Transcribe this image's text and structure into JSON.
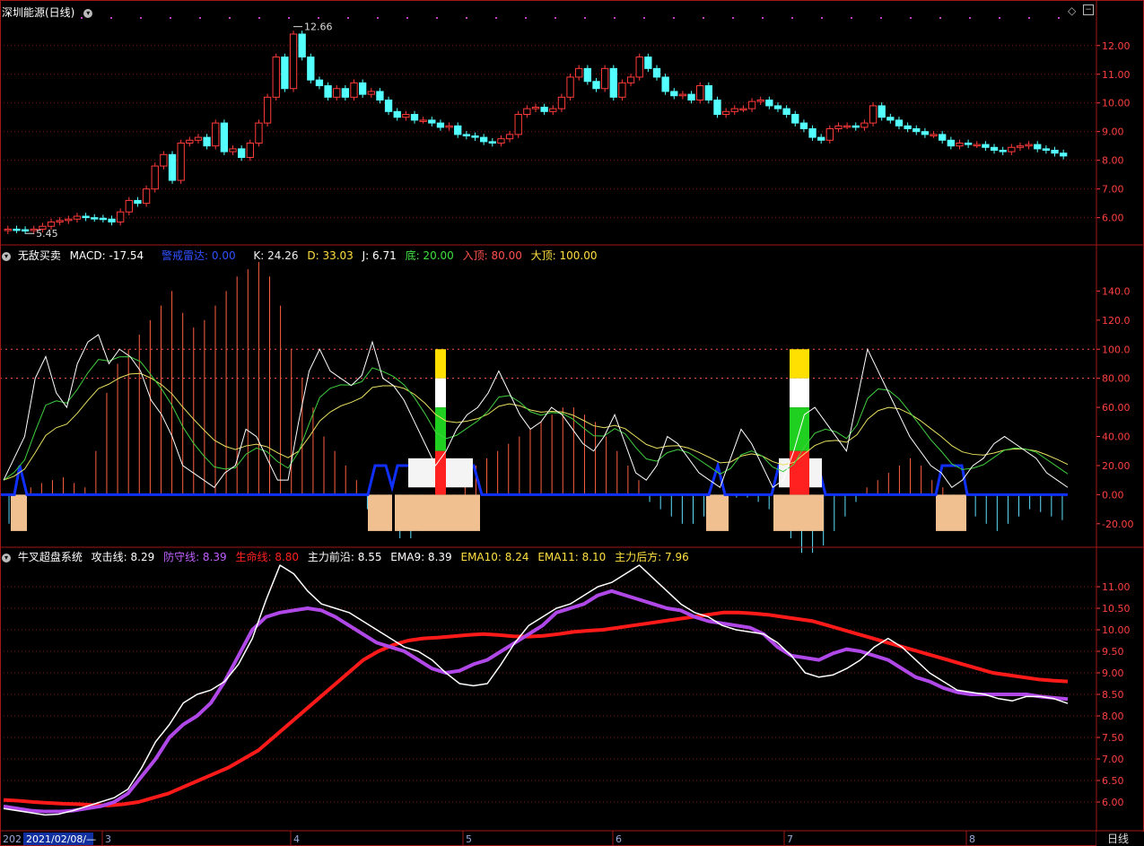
{
  "panel1": {
    "title": "深圳能源(日线)",
    "y_ticks": [
      "12.00",
      "11.00",
      "10.00",
      "9.00",
      "8.00",
      "7.00",
      "6.00"
    ],
    "high_label": "12.66",
    "low_label": "5.45"
  },
  "panel2": {
    "name": "无敌买卖",
    "macd_label": "MACD: -17.54",
    "alert_label": "警戒雷达: 0.00",
    "k_label": "K: 24.26",
    "d_label": "D: 33.03",
    "j_label": "J: 6.71",
    "bottom_label": "底: 20.00",
    "enter_label": "入顶: 80.00",
    "big_top_label": "大顶: 100.00",
    "y_ticks": [
      "140.0",
      "120.0",
      "100.0",
      "80.00",
      "60.00",
      "40.00",
      "20.00",
      "0.00",
      "-20.00"
    ]
  },
  "panel3": {
    "name": "牛叉超盘系统",
    "attack_label": "攻击线: 8.29",
    "defense_label": "防守线: 8.39",
    "life_label": "生命线: 8.80",
    "front_label": "主力前沿: 8.55",
    "ema9_label": "EMA9: 8.39",
    "ema10_label": "EMA10: 8.24",
    "ema11_label": "EMA11: 8.10",
    "rear_label": "主力后方: 7.96",
    "y_ticks": [
      "11.00",
      "10.50",
      "10.00",
      "9.50",
      "9.00",
      "8.50",
      "8.00",
      "7.50",
      "7.00",
      "6.50",
      "6.00"
    ]
  },
  "xaxis": {
    "prefix": "202",
    "date_box": "2021/02/08/—",
    "months": [
      "3",
      "4",
      "5",
      "6",
      "7",
      "8"
    ],
    "period": "日线"
  },
  "colors": {
    "up": "#ff3b3b",
    "down": "#54ffff",
    "attack": "#ffffff",
    "defense": "#b048e8",
    "life": "#ff1a1a",
    "ema": "#e8e070",
    "grid": "#8a1010",
    "axis_text": "#ff4040"
  },
  "chart_data": [
    {
      "type": "candlestick",
      "title": "深圳能源(日线)",
      "ylim": [
        5.3,
        12.9
      ],
      "annotations": [
        {
          "label": "12.66",
          "value": 12.66
        },
        {
          "label": "5.45",
          "value": 5.45
        }
      ],
      "close": [
        5.6,
        5.58,
        5.55,
        5.6,
        5.7,
        5.85,
        5.9,
        5.95,
        6.05,
        6.0,
        5.98,
        5.95,
        5.85,
        6.2,
        6.6,
        6.5,
        7.0,
        7.8,
        8.2,
        7.3,
        8.6,
        8.7,
        8.8,
        8.5,
        9.3,
        8.3,
        8.4,
        8.1,
        8.6,
        9.3,
        10.2,
        11.6,
        10.5,
        12.4,
        11.6,
        10.8,
        10.6,
        10.2,
        10.5,
        10.2,
        10.7,
        10.3,
        10.4,
        10.1,
        9.7,
        9.5,
        9.6,
        9.4,
        9.4,
        9.3,
        9.15,
        9.2,
        8.9,
        8.85,
        8.8,
        8.65,
        8.6,
        8.75,
        8.9,
        9.6,
        9.8,
        9.85,
        9.7,
        9.8,
        10.2,
        10.9,
        11.2,
        10.75,
        10.5,
        11.2,
        10.2,
        10.7,
        10.9,
        11.6,
        11.2,
        10.9,
        10.4,
        10.25,
        10.3,
        10.1,
        10.6,
        10.1,
        9.6,
        9.7,
        9.8,
        9.8,
        10.05,
        10.1,
        9.9,
        9.8,
        9.6,
        9.3,
        9.1,
        8.8,
        8.7,
        9.1,
        9.2,
        9.2,
        9.15,
        9.3,
        9.9,
        9.5,
        9.4,
        9.2,
        9.1,
        9.0,
        8.9,
        8.9,
        8.7,
        8.5,
        8.6,
        8.55,
        8.55,
        8.45,
        8.35,
        8.3,
        8.45,
        8.5,
        8.55,
        8.4,
        8.35,
        8.25,
        8.15
      ]
    },
    {
      "type": "line",
      "name": "无敌买卖",
      "ylim": [
        -30,
        160
      ],
      "reference_lines": {
        "底": 20.0,
        "入顶": 80.0,
        "大顶": 100.0
      },
      "series": [
        {
          "name": "K",
          "last": 24.26
        },
        {
          "name": "D",
          "last": 33.03
        },
        {
          "name": "J",
          "last": 6.71
        },
        {
          "name": "MACD",
          "last": -17.54
        },
        {
          "name": "警戒雷达",
          "last": 0.0
        }
      ],
      "j": [
        10,
        25,
        40,
        80,
        95,
        70,
        60,
        90,
        105,
        110,
        90,
        100,
        95,
        85,
        65,
        55,
        40,
        20,
        15,
        10,
        5,
        15,
        20,
        45,
        40,
        25,
        10,
        10,
        50,
        85,
        100,
        85,
        80,
        75,
        82,
        105,
        80,
        75,
        65,
        50,
        35,
        20,
        30,
        45,
        55,
        60,
        70,
        85,
        70,
        55,
        45,
        50,
        60,
        55,
        45,
        35,
        30,
        40,
        55,
        35,
        15,
        10,
        20,
        40,
        35,
        25,
        15,
        10,
        5,
        25,
        45,
        35,
        20,
        5,
        10,
        30,
        55,
        60,
        50,
        40,
        30,
        65,
        100,
        85,
        70,
        55,
        40,
        30,
        20,
        15,
        5,
        10,
        20,
        25,
        35,
        40,
        35,
        30,
        25,
        15,
        10,
        5
      ],
      "macd": [
        -20,
        -15,
        5,
        8,
        10,
        12,
        8,
        5,
        30,
        70,
        90,
        100,
        110,
        120,
        130,
        140,
        125,
        115,
        120,
        130,
        140,
        150,
        155,
        160,
        150,
        130,
        100,
        80,
        60,
        40,
        30,
        20,
        10,
        -10,
        -20,
        -25,
        -30,
        -30,
        -25,
        -20,
        -15,
        -10,
        10,
        20,
        25,
        30,
        35,
        40,
        45,
        50,
        55,
        60,
        60,
        55,
        50,
        40,
        30,
        20,
        10,
        -5,
        -10,
        -15,
        -20,
        -20,
        -15,
        -10,
        -5,
        -2,
        -2,
        -5,
        -10,
        -20,
        -30,
        -40,
        -40,
        -35,
        -25,
        -15,
        -5,
        5,
        10,
        15,
        20,
        25,
        20,
        10,
        5,
        -5,
        -10,
        -15,
        -20,
        -25,
        -20,
        -15,
        -10,
        -12,
        -15,
        -17.5
      ]
    },
    {
      "type": "line",
      "name": "牛叉超盘系统",
      "ylim": [
        5.5,
        11.5
      ],
      "series": [
        {
          "name": "攻击线",
          "last": 8.29,
          "values": [
            5.85,
            5.8,
            5.75,
            5.7,
            5.72,
            5.8,
            5.9,
            6.0,
            6.1,
            6.3,
            6.8,
            7.4,
            7.8,
            8.3,
            8.5,
            8.6,
            8.8,
            9.2,
            9.8,
            10.7,
            11.5,
            11.3,
            10.9,
            10.6,
            10.5,
            10.4,
            10.2,
            10.0,
            9.8,
            9.6,
            9.5,
            9.3,
            9.0,
            8.75,
            8.7,
            8.75,
            9.2,
            9.7,
            10.1,
            10.3,
            10.5,
            10.6,
            10.8,
            11.0,
            11.1,
            11.3,
            11.5,
            11.2,
            10.9,
            10.6,
            10.4,
            10.3,
            10.1,
            10.0,
            9.95,
            9.9,
            9.7,
            9.4,
            9.0,
            8.9,
            8.95,
            9.1,
            9.3,
            9.6,
            9.8,
            9.6,
            9.3,
            9.0,
            8.8,
            8.6,
            8.55,
            8.5,
            8.4,
            8.35,
            8.45,
            8.45,
            8.4,
            8.29
          ]
        },
        {
          "name": "防守线",
          "last": 8.39,
          "values": [
            5.9,
            5.85,
            5.8,
            5.78,
            5.78,
            5.8,
            5.85,
            5.9,
            6.0,
            6.2,
            6.6,
            7.0,
            7.5,
            7.8,
            8.0,
            8.3,
            8.8,
            9.4,
            10.0,
            10.3,
            10.4,
            10.45,
            10.5,
            10.45,
            10.3,
            10.1,
            9.9,
            9.7,
            9.6,
            9.5,
            9.3,
            9.1,
            9.0,
            9.05,
            9.2,
            9.3,
            9.5,
            9.7,
            9.9,
            10.1,
            10.4,
            10.5,
            10.6,
            10.8,
            10.9,
            10.8,
            10.7,
            10.6,
            10.5,
            10.45,
            10.3,
            10.2,
            10.15,
            10.1,
            10.05,
            9.9,
            9.6,
            9.4,
            9.35,
            9.3,
            9.45,
            9.55,
            9.5,
            9.4,
            9.3,
            9.1,
            8.9,
            8.8,
            8.65,
            8.55,
            8.5,
            8.5,
            8.5,
            8.5,
            8.5,
            8.45,
            8.42,
            8.39
          ]
        },
        {
          "name": "生命线",
          "last": 8.8,
          "values": [
            6.05,
            6.03,
            6.0,
            5.98,
            5.96,
            5.95,
            5.93,
            5.92,
            5.95,
            6.0,
            6.1,
            6.2,
            6.35,
            6.5,
            6.65,
            6.8,
            7.0,
            7.2,
            7.5,
            7.8,
            8.1,
            8.4,
            8.7,
            9.0,
            9.3,
            9.5,
            9.65,
            9.75,
            9.8,
            9.82,
            9.85,
            9.88,
            9.9,
            9.88,
            9.85,
            9.84,
            9.86,
            9.9,
            9.95,
            9.98,
            10.0,
            10.05,
            10.1,
            10.15,
            10.2,
            10.25,
            10.3,
            10.35,
            10.4,
            10.4,
            10.38,
            10.35,
            10.3,
            10.25,
            10.2,
            10.1,
            10.0,
            9.9,
            9.8,
            9.7,
            9.6,
            9.5,
            9.4,
            9.3,
            9.2,
            9.1,
            9.0,
            8.95,
            8.9,
            8.85,
            8.82,
            8.8
          ]
        },
        {
          "name": "主力前沿",
          "last": 8.55
        },
        {
          "name": "EMA9",
          "last": 8.39
        },
        {
          "name": "EMA10",
          "last": 8.24
        },
        {
          "name": "EMA11",
          "last": 8.1
        },
        {
          "name": "主力后方",
          "last": 7.96
        }
      ]
    }
  ]
}
